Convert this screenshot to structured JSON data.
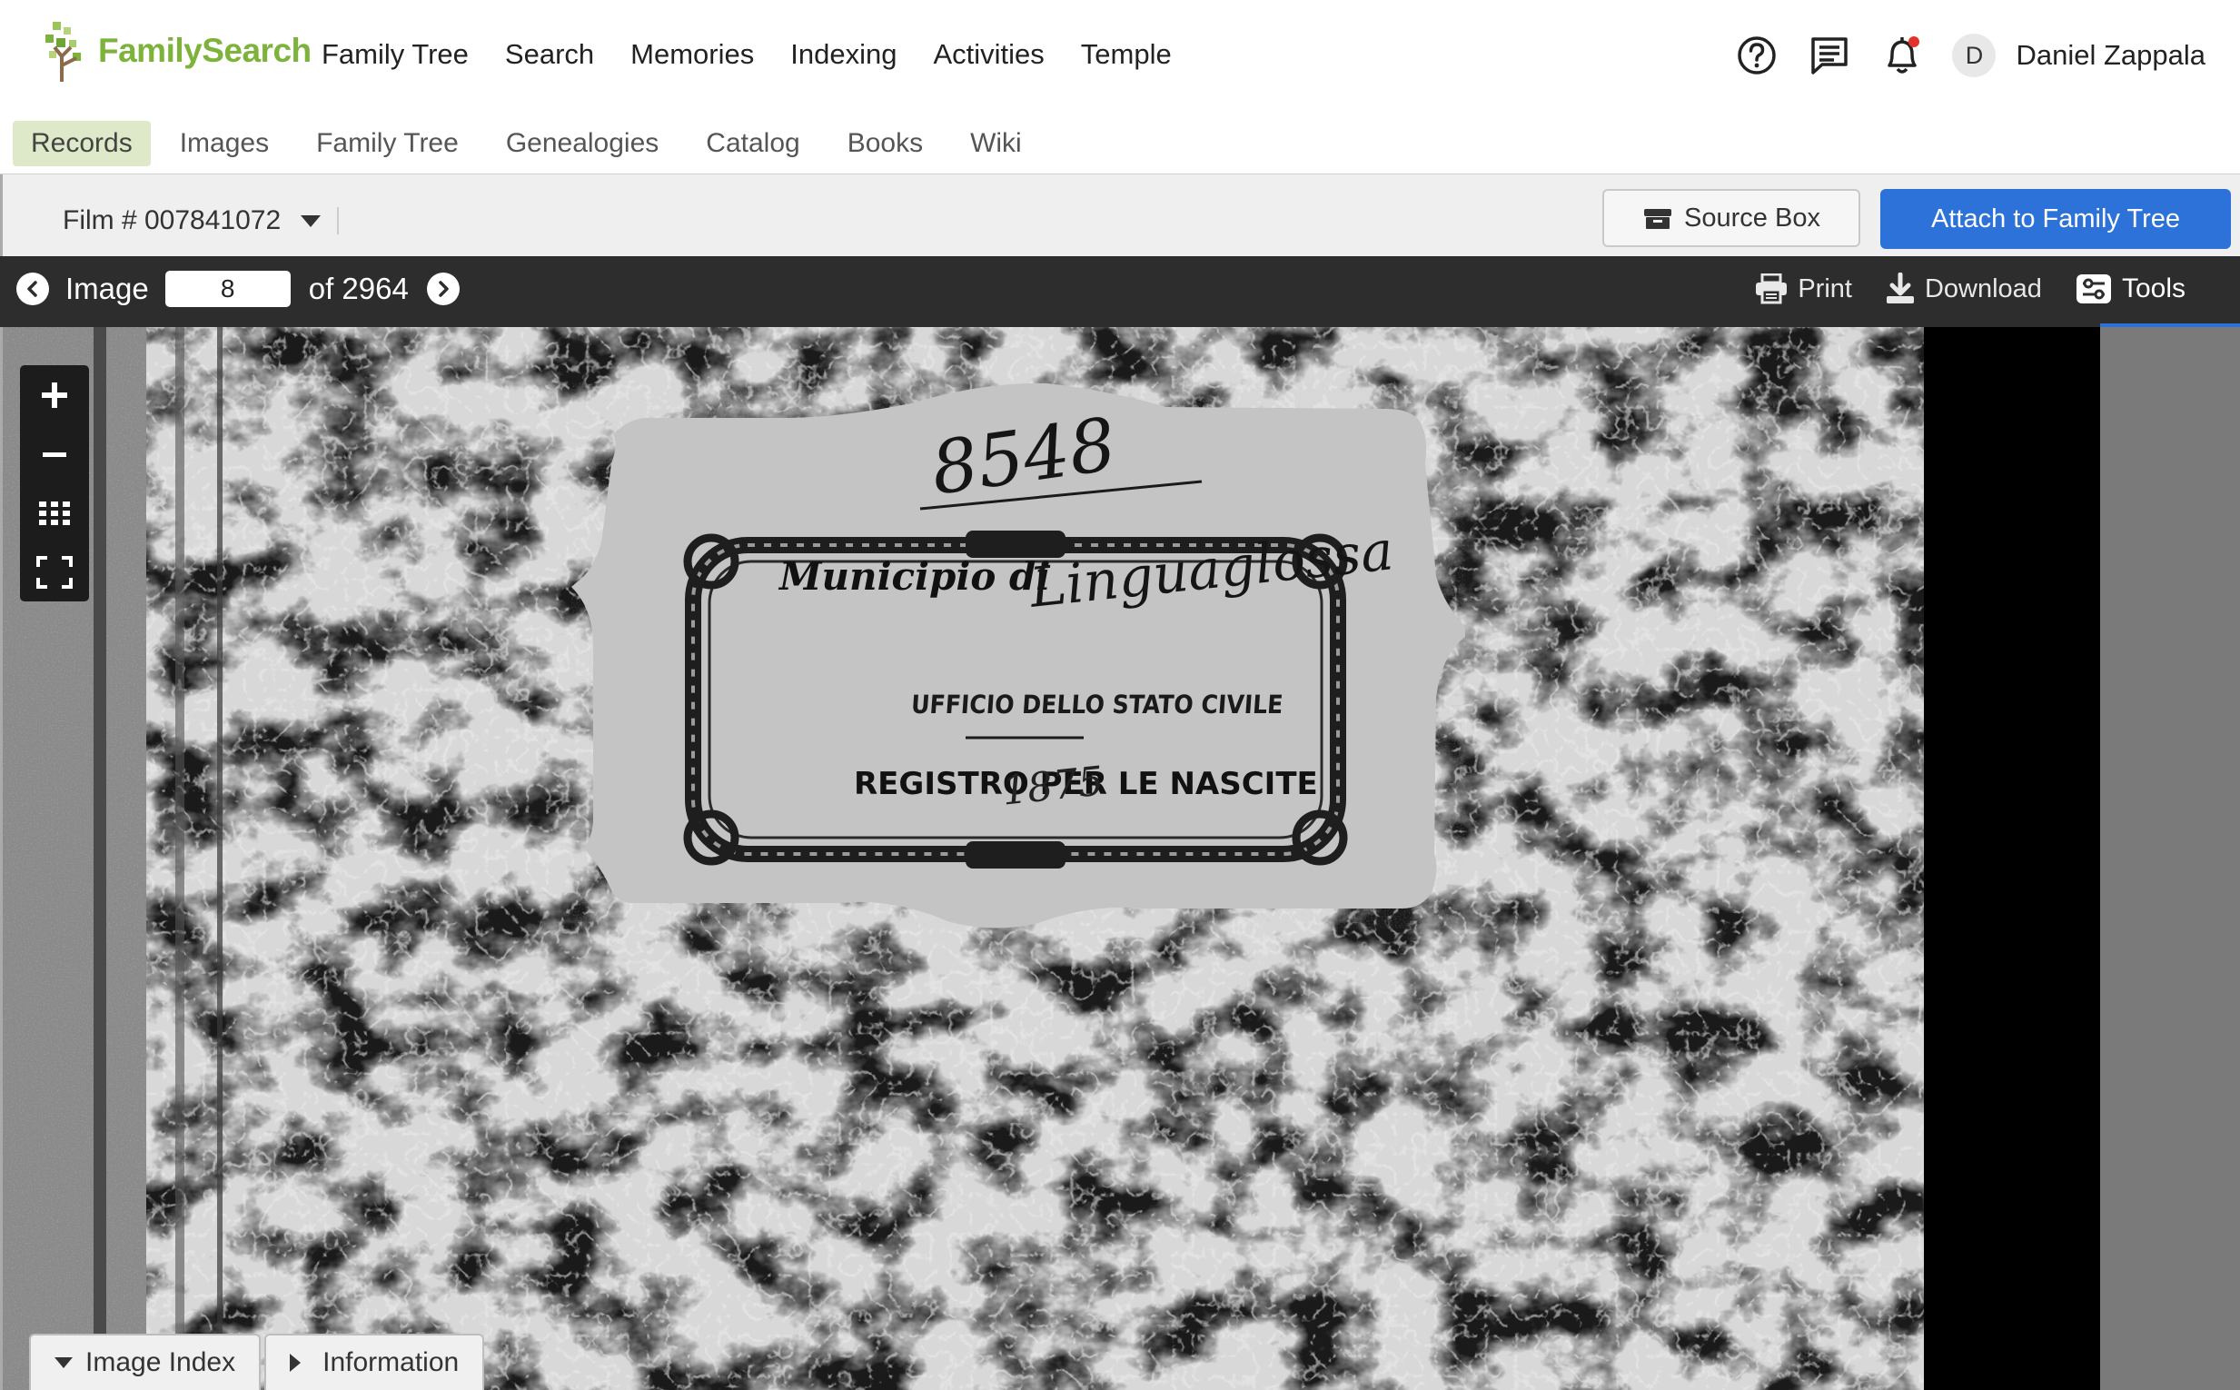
{
  "header": {
    "logo_text": "FamilySearch",
    "nav": [
      "Family Tree",
      "Search",
      "Memories",
      "Indexing",
      "Activities",
      "Temple"
    ],
    "icons": [
      "help-icon",
      "messages-icon",
      "notifications-icon"
    ],
    "avatar_initial": "D",
    "user_name": "Daniel Zappala",
    "brand_color": "#7db33b",
    "notification_color": "#e4312b"
  },
  "subnav": {
    "items": [
      "Records",
      "Images",
      "Family Tree",
      "Genealogies",
      "Catalog",
      "Books",
      "Wiki"
    ],
    "active": "Records"
  },
  "filmbar": {
    "film_label": "Film # 007841072",
    "source_box_label": "Source Box",
    "attach_label": "Attach to Family Tree",
    "accent_color": "#2d72d9"
  },
  "viewer": {
    "image_label": "Image",
    "image_number": "8",
    "of_label": "of 2964",
    "print_label": "Print",
    "download_label": "Download",
    "tools_label": "Tools",
    "zoom_controls": [
      "zoom-in-icon",
      "zoom-out-icon",
      "grid-view-icon",
      "fullscreen-icon"
    ]
  },
  "document": {
    "number": "8548",
    "municipio": "Municipio di",
    "handwritten_place": "Linguaglossa",
    "ufficio": "UFFICIO DELLO STATO CIVILE",
    "registro": "REGISTRO PER LE NASCITE",
    "year": "1875"
  },
  "bottom_tabs": {
    "image_index": "Image Index",
    "information": "Information"
  }
}
